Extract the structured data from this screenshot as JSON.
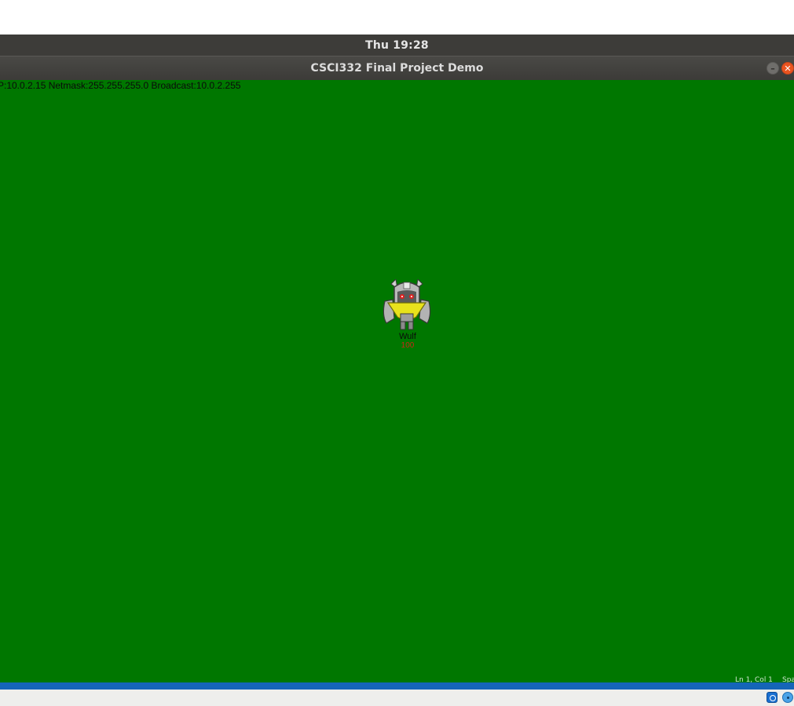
{
  "system": {
    "clock": "Thu 19:28"
  },
  "window": {
    "title": "CSCI332 Final Project Demo",
    "minimize_glyph": "–",
    "close_glyph": "✕"
  },
  "game": {
    "background_color": "#007700",
    "net_info": "P:10.0.2.15 Netmask:255.255.255.0 Broadcast:10.0.2.255",
    "player": {
      "name": "Wulf",
      "health": "100"
    }
  },
  "editor_status": {
    "position": "Ln 1, Col 1",
    "indent": "Spa"
  },
  "tray": {
    "icons": [
      "network-icon",
      "disc-icon"
    ]
  }
}
